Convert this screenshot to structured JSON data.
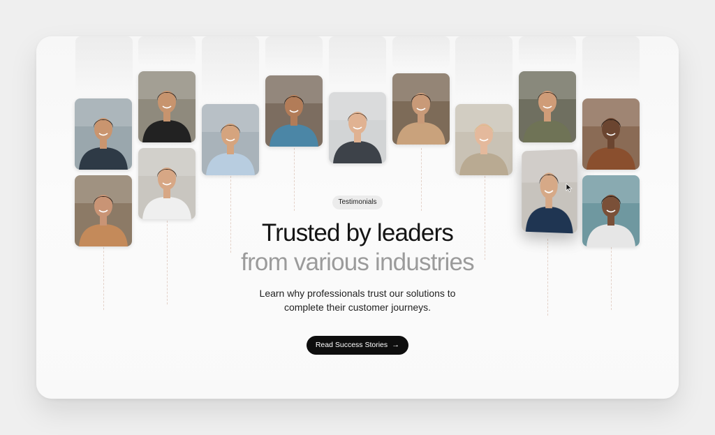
{
  "badge": "Testimonials",
  "heading": {
    "line1": "Trusted by leaders",
    "line2": "from various industries"
  },
  "description": {
    "line1": "Learn why professionals trust our solutions to",
    "line2": "complete their customer journeys."
  },
  "cta": {
    "label": "Read Success Stories",
    "arrow": "→"
  },
  "colors": {
    "page_bg": "#efefef",
    "card_bg": "#f9f9f9",
    "heading_dark": "#151515",
    "heading_muted": "#9b9b9b",
    "cta_bg": "#0e0e0e"
  },
  "portraits": [
    {
      "name": "man-glasses-blazer",
      "bg": "#9aa7ad",
      "skin": "#c9956f",
      "hair": "#2a2420",
      "shirt": "#2e3a46"
    },
    {
      "name": "woman-long-hair-office",
      "bg": "#8c7a66",
      "skin": "#c99475",
      "hair": "#2b1f19",
      "shirt": "#c48a5a"
    },
    {
      "name": "man-black-tshirt",
      "bg": "#8f8a7d",
      "skin": "#c7946e",
      "hair": "#2e2420",
      "shirt": "#222"
    },
    {
      "name": "man-white-tshirt",
      "bg": "#c9c6c0",
      "skin": "#d7a785",
      "hair": "#3b2c22",
      "shirt": "#efefef"
    },
    {
      "name": "man-glasses-city",
      "bg": "#a9b3ba",
      "skin": "#d5a47e",
      "hair": "#4a3a2c",
      "shirt": "#b8cde0"
    },
    {
      "name": "man-arms-crossed",
      "bg": "#7c6d60",
      "skin": "#b27c58",
      "hair": "#1f1915",
      "shirt": "#4b86a6"
    },
    {
      "name": "man-suit-tie",
      "bg": "#d2d4d5",
      "skin": "#e0b292",
      "hair": "#5c4330",
      "shirt": "#3d4249"
    },
    {
      "name": "woman-beige-jacket",
      "bg": "#7d6b58",
      "skin": "#c99a78",
      "hair": "#241914",
      "shirt": "#c9a27c"
    },
    {
      "name": "woman-blonde-laptop",
      "bg": "#c9c2b5",
      "skin": "#e4b99c",
      "hair": "#d8bd8a",
      "shirt": "#b9aa92"
    },
    {
      "name": "man-olive-shirt",
      "bg": "#6f6f60",
      "skin": "#cf9c78",
      "hair": "#3a2b21",
      "shirt": "#6f7356"
    },
    {
      "name": "man-navy-suit-desk",
      "bg": "#c7c3bd",
      "skin": "#d6a987",
      "hair": "#161210",
      "shirt": "#1f3552"
    },
    {
      "name": "woman-curly-hair",
      "bg": "#8a6b55",
      "skin": "#6b4530",
      "hair": "#1a1410",
      "shirt": "#8a4f2e"
    },
    {
      "name": "man-light-blazer",
      "bg": "#6f98a0",
      "skin": "#7a5038",
      "hair": "#1a1410",
      "shirt": "#e6e6e6"
    }
  ]
}
